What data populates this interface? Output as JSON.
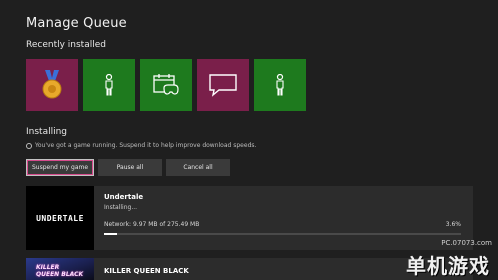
{
  "page": {
    "title": "Manage Queue"
  },
  "recent": {
    "label": "Recently installed",
    "tiles": [
      {
        "icon": "medal-icon",
        "color": "#7a1f4a"
      },
      {
        "icon": "avatar-figure-icon",
        "color": "#1e7a1e"
      },
      {
        "icon": "calendar-controller-icon",
        "color": "#1e7a1e"
      },
      {
        "icon": "chat-bubble-icon",
        "color": "#7a1f4a"
      },
      {
        "icon": "avatar-figure-icon",
        "color": "#1e7a1e"
      }
    ]
  },
  "installing": {
    "label": "Installing",
    "info": "You've got a game running. Suspend it to help improve download speeds.",
    "buttons": {
      "suspend": "Suspend my game",
      "pause": "Pause all",
      "cancel": "Cancel all"
    },
    "items": [
      {
        "name": "Undertale",
        "art_text": "UNDERTALE",
        "status": "Installing...",
        "network": "Network: 9.97 MB of 275.49 MB",
        "percent": "3.6%",
        "progress": 0.036
      },
      {
        "name": "KILLER QUEEN BLACK",
        "art_text": "KILLER QUEEN BLACK"
      }
    ]
  },
  "watermark": {
    "site": "PC.07073.com",
    "brand": "单机游戏"
  },
  "colors": {
    "background": "#1f1f1f",
    "green_tile": "#1e7a1e",
    "magenta_tile": "#7a1f4a",
    "focus_accent": "#d54b8c"
  }
}
